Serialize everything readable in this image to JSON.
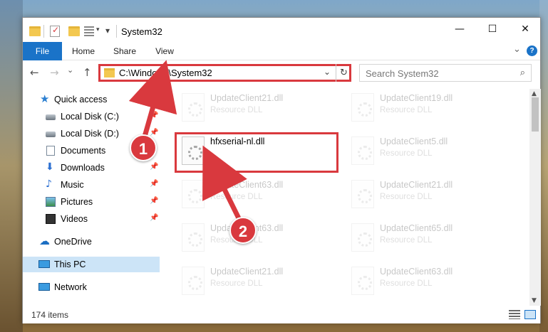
{
  "window": {
    "title": "System32",
    "minimize_glyph": "—",
    "maximize_glyph": "☐",
    "close_glyph": "✕"
  },
  "ribbon": {
    "tabs": [
      "File",
      "Home",
      "Share",
      "View"
    ],
    "expand_glyph": "⌄",
    "help_glyph": "?"
  },
  "nav": {
    "back_glyph": "←",
    "forward_glyph": "→",
    "recent_glyph": "⌄",
    "up_glyph": "↑",
    "address": "C:\\Windows\\System32",
    "address_dropdown_glyph": "⌄",
    "refresh_glyph": "↻",
    "search_placeholder": "Search System32",
    "search_glyph": "⌕"
  },
  "sidebar": {
    "items": [
      {
        "label": "Quick access",
        "icon": "star-icon"
      },
      {
        "label": "Local Disk (C:)",
        "icon": "drive-icon"
      },
      {
        "label": "Local Disk (D:)",
        "icon": "drive-icon"
      },
      {
        "label": "Documents",
        "icon": "documents-icon"
      },
      {
        "label": "Downloads",
        "icon": "download-icon"
      },
      {
        "label": "Music",
        "icon": "music-icon"
      },
      {
        "label": "Pictures",
        "icon": "pictures-icon"
      },
      {
        "label": "Videos",
        "icon": "videos-icon"
      },
      {
        "label": "OneDrive",
        "icon": "cloud-icon"
      },
      {
        "label": "This PC",
        "icon": "computer-icon"
      },
      {
        "label": "Network",
        "icon": "network-icon"
      }
    ],
    "pin_glyph": "📌"
  },
  "files": {
    "left_column": [
      {
        "name": "UpdateClient21.dll",
        "type": "Resource DLL"
      },
      {
        "name": "hfxserial-nl.dll",
        "type": ""
      },
      {
        "name": "UpdateClient63.dll",
        "type": "Resource DLL"
      },
      {
        "name": "UpdateClient63.dll",
        "type": "Resource DLL"
      },
      {
        "name": "UpdateClient21.dll",
        "type": "Resource DLL"
      }
    ],
    "right_column": [
      {
        "name": "UpdateClient19.dll",
        "type": "Resource DLL"
      },
      {
        "name": "UpdateClient5.dll",
        "type": "Resource DLL"
      },
      {
        "name": "UpdateClient21.dll",
        "type": "Resource DLL"
      },
      {
        "name": "UpdateClient65.dll",
        "type": "Resource DLL"
      },
      {
        "name": "UpdateClient63.dll",
        "type": "Resource DLL"
      }
    ]
  },
  "status": {
    "item_count": "174 items"
  },
  "annotations": {
    "step1": "1",
    "step2": "2",
    "color": "#d9393e"
  }
}
